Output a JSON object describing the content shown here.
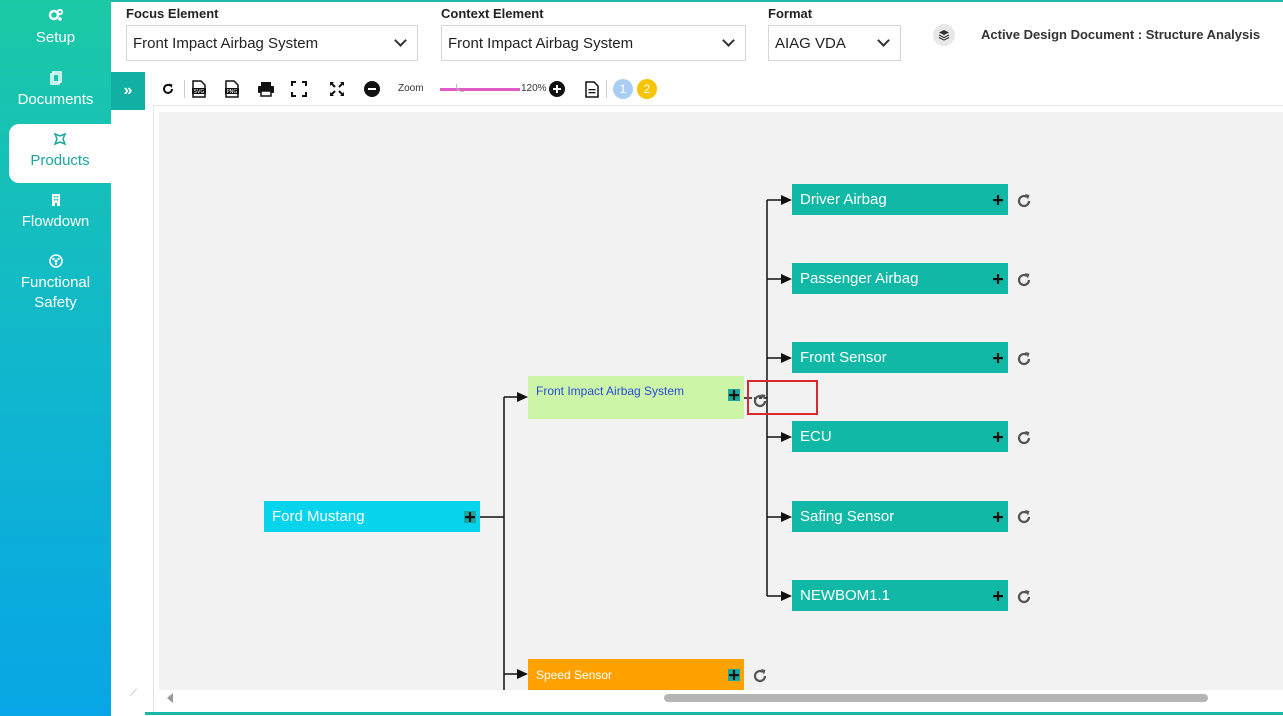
{
  "sidebar": {
    "items": [
      {
        "id": "setup",
        "label": "Setup",
        "icon": "gears-icon"
      },
      {
        "id": "documents",
        "label": "Documents",
        "icon": "documents-icon"
      },
      {
        "id": "products",
        "label": "Products",
        "icon": "product-icon",
        "active": true
      },
      {
        "id": "flowdown",
        "label": "Flowdown",
        "icon": "building-icon"
      },
      {
        "id": "functional-safety",
        "label": "Functional Safety",
        "icon": "hazard-icon"
      }
    ]
  },
  "topbar": {
    "focus_label": "Focus Element",
    "focus_value": "Front Impact Airbag System",
    "context_label": "Context Element",
    "context_value": "Front Impact Airbag System",
    "format_label": "Format",
    "format_value": "AIAG VDA",
    "active_doc": "Active Design Document : Structure Analysis"
  },
  "toolbar": {
    "zoom_label": "Zoom",
    "zoom_value": "120%",
    "badge1": "1",
    "badge2": "2"
  },
  "diagram": {
    "root": {
      "label": "Ford Mustang",
      "color": "#06d3ec"
    },
    "level1": [
      {
        "label": "Front Impact Airbag System",
        "color": "#ccf5a8",
        "text_color": "#2a4bd6"
      },
      {
        "label": "Speed Sensor",
        "color": "#ffa200"
      }
    ],
    "level2": [
      {
        "label": "Driver Airbag"
      },
      {
        "label": "Passenger Airbag"
      },
      {
        "label": "Front Sensor"
      },
      {
        "label": "ECU"
      },
      {
        "label": "Safing Sensor"
      },
      {
        "label": "NEWBOM1.1"
      }
    ],
    "level2_color": "#11b8a6"
  },
  "colors": {
    "accent": "#19b8a8",
    "highlight": "#d9282f"
  }
}
